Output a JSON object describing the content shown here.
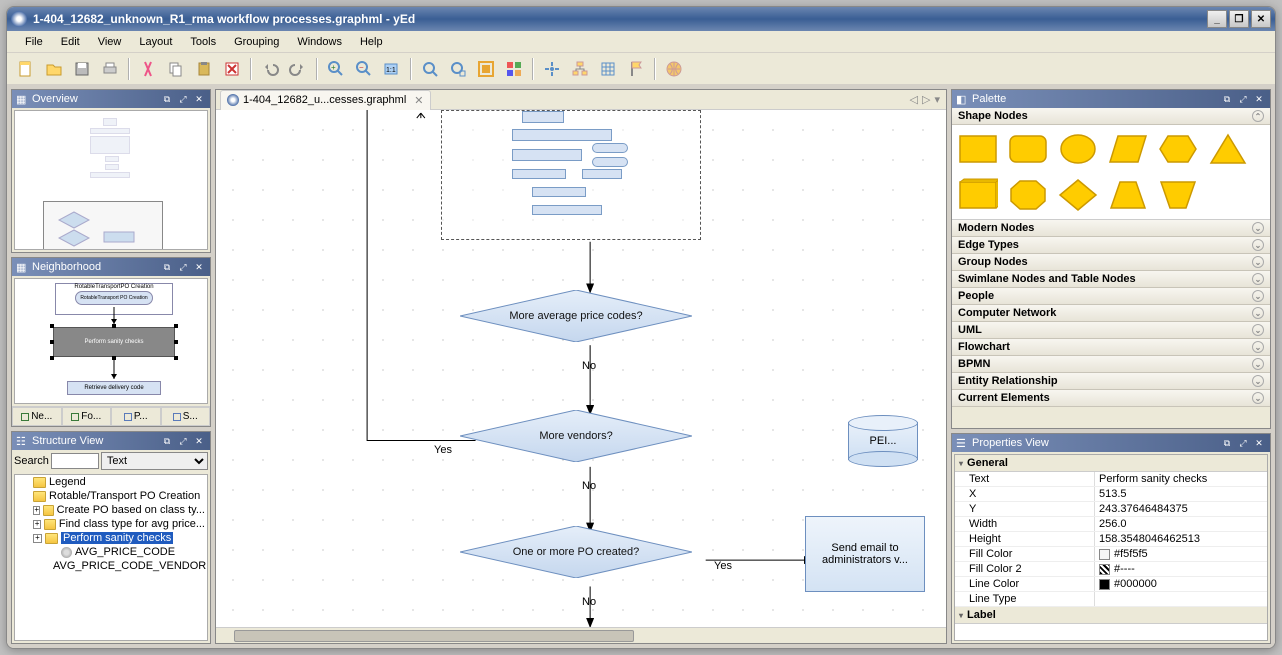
{
  "title": "1-404_12682_unknown_R1_rma workflow processes.graphml - yEd",
  "menu": [
    "File",
    "Edit",
    "View",
    "Layout",
    "Tools",
    "Grouping",
    "Windows",
    "Help"
  ],
  "tab": {
    "label": "1-404_12682_u...cesses.graphml"
  },
  "panels": {
    "overview": "Overview",
    "neighborhood": "Neighborhood",
    "structure": "Structure View",
    "palette": "Palette",
    "properties": "Properties View"
  },
  "nbh_tabs": [
    "Ne...",
    "Fo...",
    "P...",
    "S..."
  ],
  "nbh_content": {
    "group_title": "RotableTransportPO Creation",
    "node1": "RotableTransport PO Creation",
    "sel": "Perform sanity checks",
    "node3": "Retrieve delivery code"
  },
  "structure": {
    "search_label": "Search",
    "search_mode": "Text",
    "nodes": [
      {
        "indent": 0,
        "toggle": "",
        "icon": "folder",
        "label": "Legend"
      },
      {
        "indent": 0,
        "toggle": "",
        "icon": "folder",
        "label": "Rotable/Transport PO Creation"
      },
      {
        "indent": 1,
        "toggle": "+",
        "icon": "folder",
        "label": "Create PO based on class ty..."
      },
      {
        "indent": 1,
        "toggle": "+",
        "icon": "folder",
        "label": "Find class type for avg price..."
      },
      {
        "indent": 1,
        "toggle": "+",
        "icon": "folder",
        "label": "Perform sanity checks",
        "sel": true
      },
      {
        "indent": 2,
        "toggle": "",
        "icon": "leaf",
        "label": "AVG_PRICE_CODE"
      },
      {
        "indent": 2,
        "toggle": "",
        "icon": "leaf",
        "label": "AVG_PRICE_CODE_VENDOR..."
      }
    ]
  },
  "palette": {
    "open_section": "Shape Nodes",
    "sections": [
      "Modern Nodes",
      "Edge Types",
      "Group Nodes",
      "Swimlane Nodes and Table Nodes",
      "People",
      "Computer Network",
      "UML",
      "Flowchart",
      "BPMN",
      "Entity Relationship",
      "Current Elements"
    ]
  },
  "properties": {
    "section": "General",
    "items": [
      {
        "k": "Text",
        "v": "Perform sanity checks"
      },
      {
        "k": "X",
        "v": "513.5"
      },
      {
        "k": "Y",
        "v": "243.37646484375"
      },
      {
        "k": "Width",
        "v": "256.0"
      },
      {
        "k": "Height",
        "v": "158.3548046462513"
      },
      {
        "k": "Fill Color",
        "v": "#f5f5f5",
        "swatch": "#f5f5f5",
        "pattern": false
      },
      {
        "k": "Fill Color 2",
        "v": "#----",
        "swatch": "",
        "pattern": true
      },
      {
        "k": "Line Color",
        "v": "#000000",
        "swatch": "#000000",
        "pattern": false
      },
      {
        "k": "Line Type",
        "v": ""
      }
    ],
    "section2": "Label"
  },
  "diagram": {
    "d1": "More average price codes?",
    "d2": "More vendors?",
    "d3": "One or more PO created?",
    "db": "PEI...",
    "box": "Send email to administrators v...",
    "no": "No",
    "yes": "Yes"
  }
}
